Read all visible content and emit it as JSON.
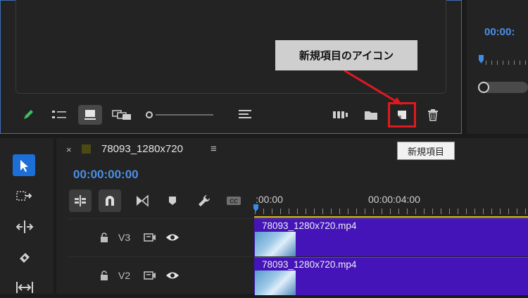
{
  "project_panel": {
    "toolbar_icons": [
      "pencil-icon",
      "list-view-icon",
      "icon-view-icon",
      "freeform-view-icon",
      "zoom-slider",
      "sort-icon",
      "automate-to-sequence-icon",
      "new-bin-icon",
      "new-item-icon",
      "trash-icon"
    ]
  },
  "annotation": {
    "callout": "新規項目のアイコン",
    "tooltip": "新規項目",
    "highlight_color": "#e0191e"
  },
  "program_monitor": {
    "timecode": "00:00:"
  },
  "timeline": {
    "close": "×",
    "sequence_name": "78093_1280x720",
    "menu": "≡",
    "timecode": "00:00:00:00",
    "ruler_labels": [
      ":00:00",
      "00:00:04:00"
    ],
    "tracks": [
      {
        "name": "V3",
        "clip": "78093_1280x720.mp4"
      },
      {
        "name": "V2",
        "clip": "78093_1280x720.mp4"
      }
    ]
  },
  "colors": {
    "accent_blue": "#4b8fe6",
    "clip_purple": "#4414b8",
    "selection_tool": "#1d6fd8"
  }
}
